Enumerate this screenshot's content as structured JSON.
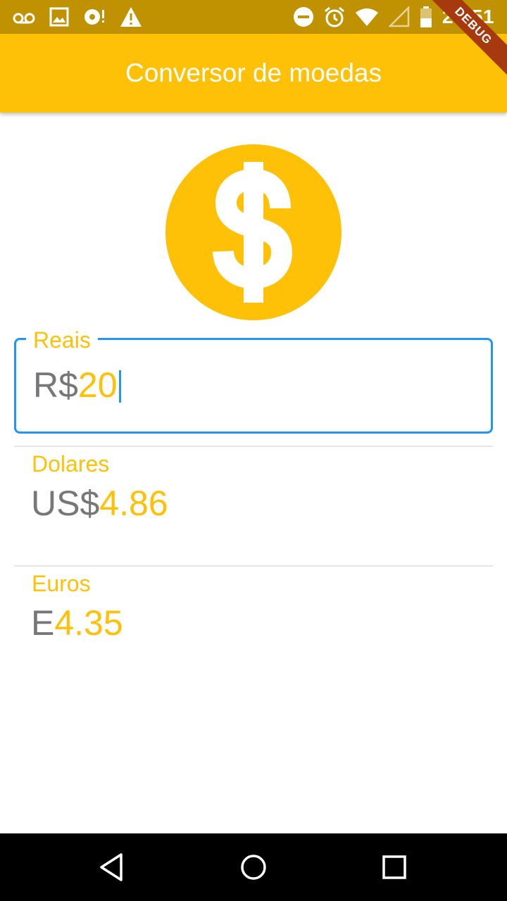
{
  "status_bar": {
    "time": "23:51",
    "left_icons": [
      "voicemail-icon",
      "image-icon",
      "sync-icon",
      "warning-icon"
    ],
    "right_icons": [
      "do-not-disturb-icon",
      "alarm-icon",
      "wifi-icon",
      "signal-icon",
      "battery-icon"
    ]
  },
  "app_bar": {
    "title": "Conversor de moedas"
  },
  "debug_banner": {
    "label": "DEBUG"
  },
  "colors": {
    "accent": "#ffc107",
    "focus": "#2196f3",
    "prefix_text": "#777777",
    "status_bar": "#c09100"
  },
  "hero": {
    "icon": "dollar-coin-icon"
  },
  "fields": {
    "reais": {
      "label": "Reais",
      "prefix": "R$",
      "value": "20"
    },
    "dolares": {
      "label": "Dolares",
      "prefix": "US$",
      "value": "4.86"
    },
    "euros": {
      "label": "Euros",
      "prefix": "E",
      "value": "4.35"
    }
  },
  "nav_bar": {
    "icons": [
      "back-icon",
      "home-icon",
      "recents-icon"
    ]
  }
}
